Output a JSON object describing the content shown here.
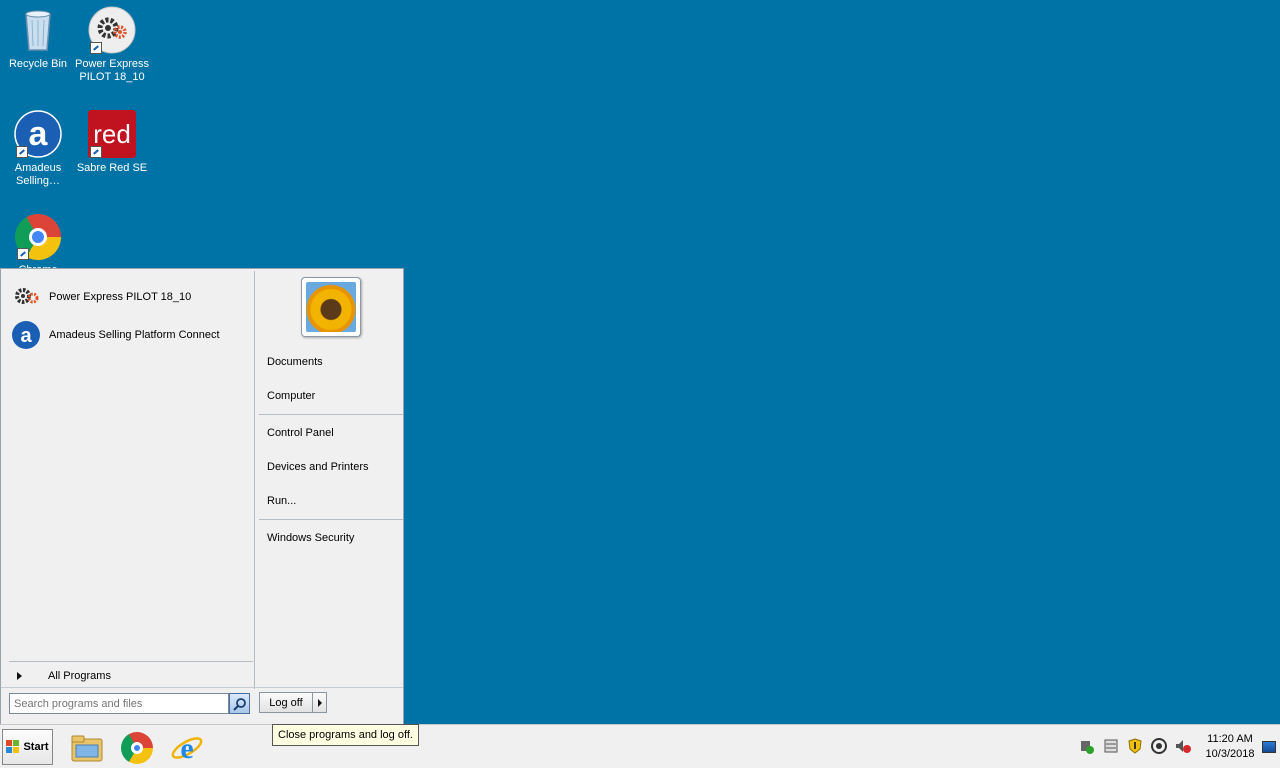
{
  "desktop": {
    "icons": [
      {
        "label": "Recycle Bin",
        "icon": "recycle-bin-icon"
      },
      {
        "label": "Power Express PILOT 18_10",
        "icon": "gears-icon"
      },
      {
        "label": "Amadeus Selling…",
        "icon": "amadeus-icon"
      },
      {
        "label": "Sabre Red SE",
        "icon": "sabre-red-icon",
        "icon_text": "red"
      },
      {
        "label": "Chrome",
        "icon": "chrome-icon"
      }
    ]
  },
  "start_menu": {
    "programs": [
      {
        "label": "Power Express PILOT 18_10",
        "icon": "gears-icon"
      },
      {
        "label": "Amadeus Selling Platform Connect",
        "icon": "amadeus-icon",
        "icon_text": "a"
      }
    ],
    "all_programs": "All Programs",
    "right_links": [
      "Documents",
      "Computer",
      "Control Panel",
      "Devices and Printers",
      "Run...",
      "Windows Security"
    ],
    "search_placeholder": "Search programs and files",
    "logoff_label": "Log off",
    "tooltip": "Close programs and log off."
  },
  "taskbar": {
    "start_label": "Start",
    "pinned": [
      "file-explorer-icon",
      "chrome-icon",
      "internet-explorer-icon"
    ],
    "tray_icons": [
      "device-check-icon",
      "network-printer-icon",
      "security-shield-icon",
      "sync-icon",
      "volume-muted-icon"
    ],
    "clock_time": "11:20 AM",
    "clock_date": "10/3/2018"
  },
  "colors": {
    "desktop": "#0073a6",
    "menu": "#f0f0f0",
    "amadeus": "#1a5fb4",
    "sabre": "#c0121f"
  }
}
